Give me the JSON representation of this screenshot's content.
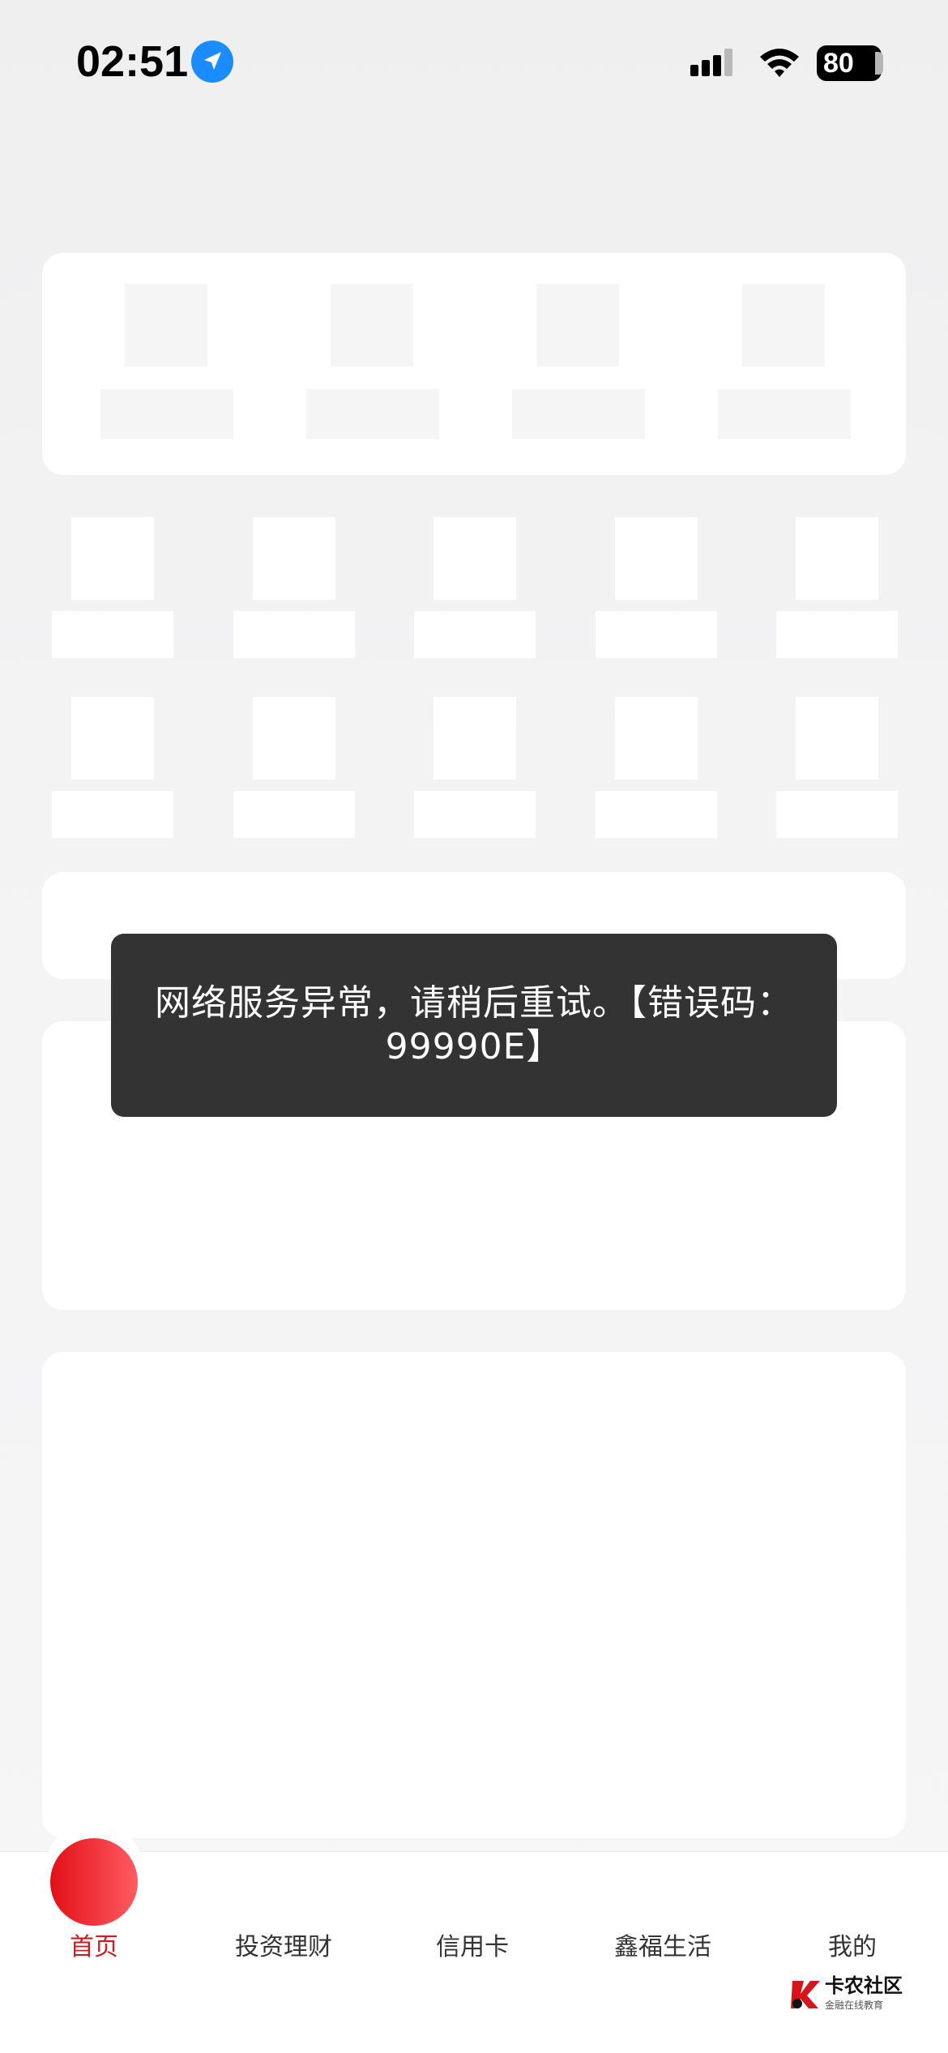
{
  "status_bar": {
    "time": "02:51",
    "battery": "80",
    "icons": [
      "location-arrow-icon",
      "cellular-signal-icon",
      "wifi-icon",
      "battery-icon"
    ]
  },
  "toast": {
    "message": "网络服务异常，请稍后重试。【错误码：\n99990E】"
  },
  "tab_bar": {
    "items": [
      {
        "label": "首页",
        "active": true
      },
      {
        "label": "投资理财",
        "active": false
      },
      {
        "label": "信用卡",
        "active": false
      },
      {
        "label": "鑫福生活",
        "active": false
      },
      {
        "label": "我的",
        "active": false
      }
    ]
  },
  "watermark": {
    "title": "卡农社区",
    "subtitle": "金融在线教育"
  },
  "colors": {
    "accent": "#cc1b22",
    "toast_bg": "#333333",
    "location_blue": "#1a8cff"
  }
}
